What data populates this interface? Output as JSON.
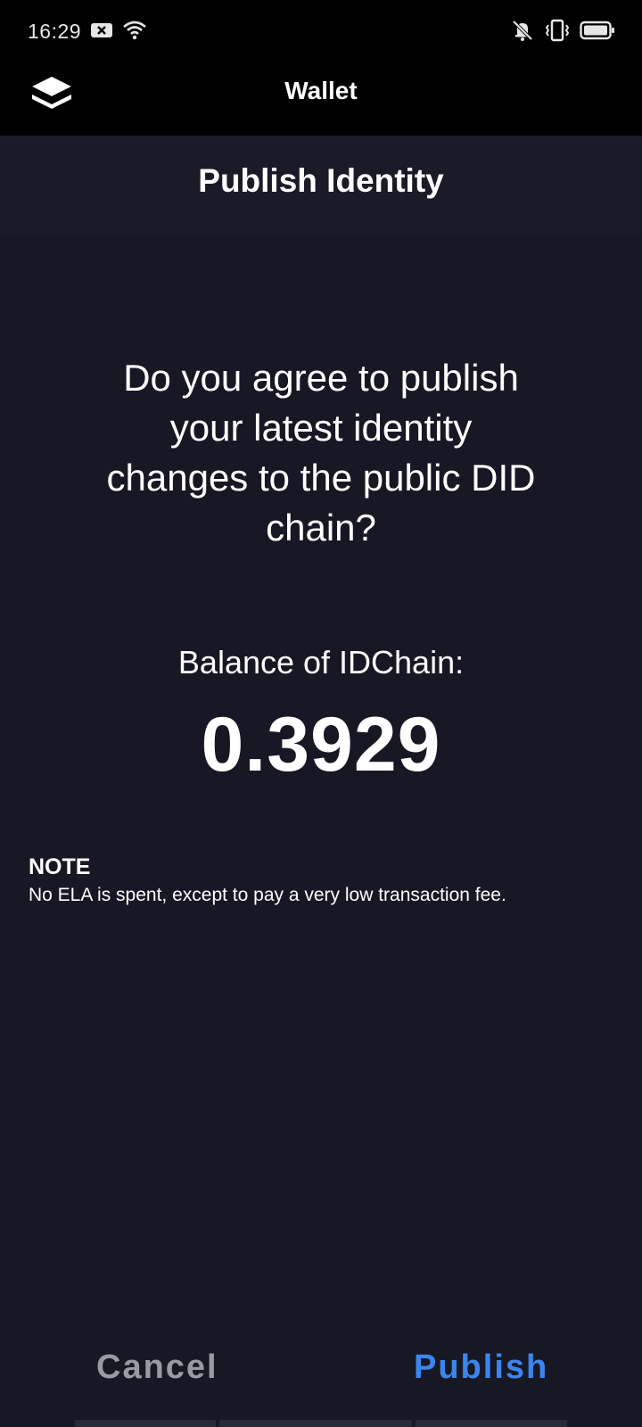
{
  "status_bar": {
    "time": "16:29",
    "left_icons": [
      "notification-x-icon",
      "wifi-icon"
    ],
    "right_icons": [
      "mute-icon",
      "vibrate-icon",
      "battery-icon"
    ]
  },
  "app_bar": {
    "title": "Wallet",
    "logo_icon": "layers-logo-icon"
  },
  "header": {
    "title": "Publish Identity"
  },
  "main": {
    "question": "Do you agree to publish your latest identity changes to the public DID chain?",
    "balance_label": "Balance of IDChain:",
    "balance_value": "0.3929",
    "note_title": "NOTE",
    "note_text": "No ELA is spent, except to pay a very low transaction fee."
  },
  "actions": {
    "cancel_label": "Cancel",
    "publish_label": "Publish"
  },
  "colors": {
    "background": "#181824",
    "header_bg": "#1b1b28",
    "bar_bg": "#000000",
    "cancel": "#9a9aa2",
    "publish": "#3b86ee"
  }
}
